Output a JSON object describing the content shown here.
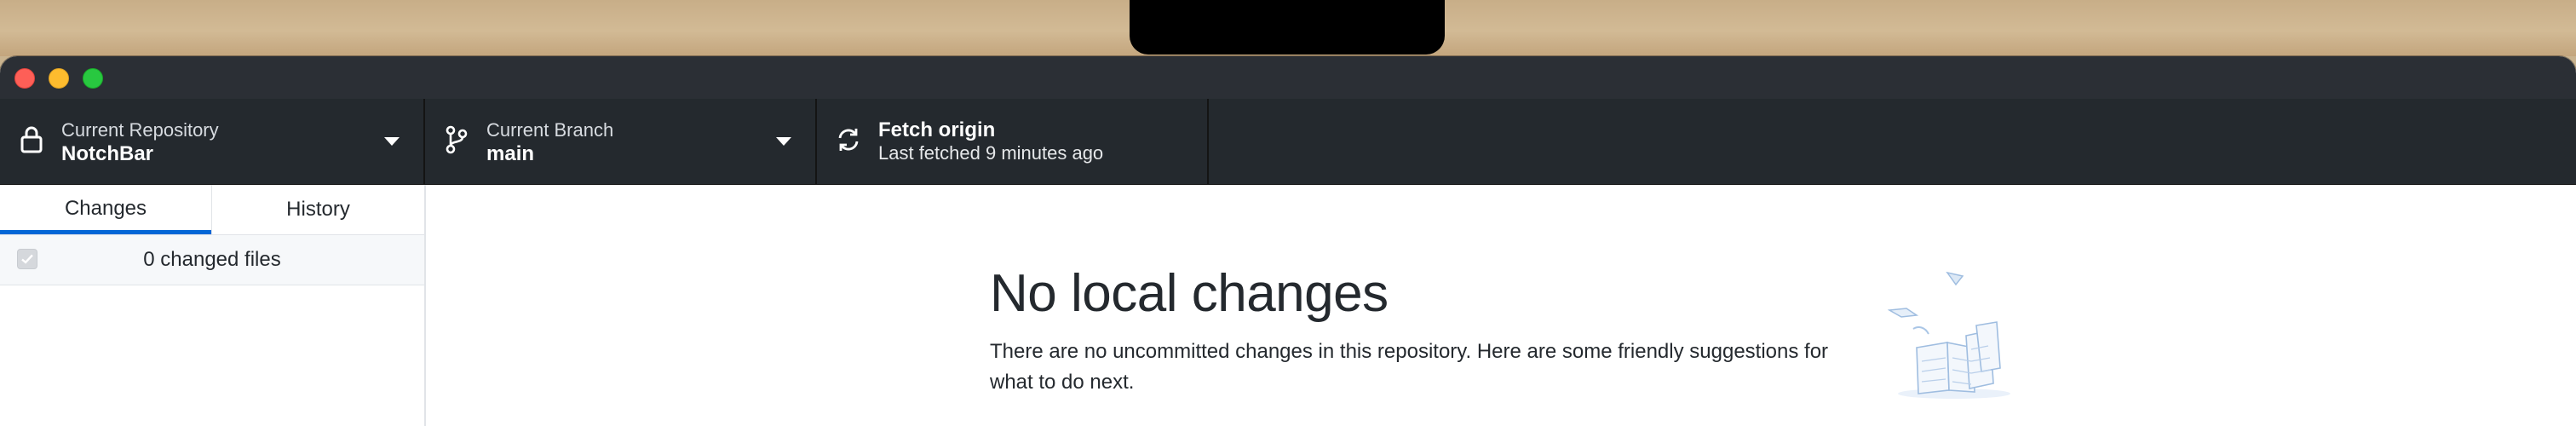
{
  "toolbar": {
    "repository": {
      "label": "Current Repository",
      "value": "NotchBar",
      "icon": "lock-icon"
    },
    "branch": {
      "label": "Current Branch",
      "value": "main",
      "icon": "git-branch-icon"
    },
    "fetch": {
      "label": "Fetch origin",
      "value": "Last fetched 9 minutes ago",
      "icon": "sync-icon"
    }
  },
  "sidebar": {
    "tabs": [
      {
        "label": "Changes",
        "selected": true
      },
      {
        "label": "History",
        "selected": false
      }
    ],
    "changed_files": "0 changed files"
  },
  "main": {
    "heading": "No local changes",
    "description": "There are no uncommitted changes in this repository. Here are some friendly suggestions for what to do next."
  },
  "colors": {
    "toolbar_bg": "#24292e",
    "accent": "#0366d6",
    "close": "#fe5f57",
    "minimize": "#febc2e",
    "maximize": "#28c840"
  }
}
